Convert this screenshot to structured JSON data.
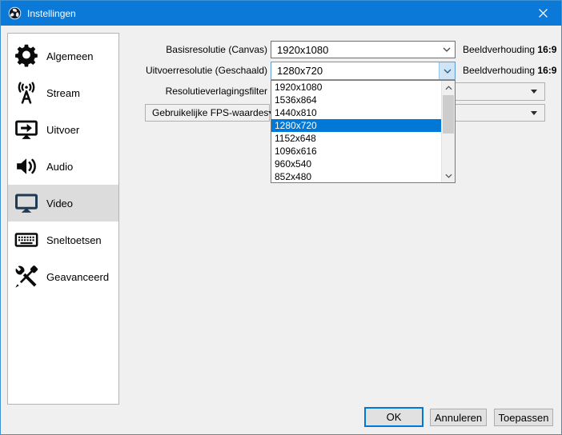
{
  "window": {
    "title": "Instellingen"
  },
  "sidebar": {
    "items": [
      {
        "label": "Algemeen",
        "icon": "gear-icon",
        "selected": false
      },
      {
        "label": "Stream",
        "icon": "broadcast-icon",
        "selected": false
      },
      {
        "label": "Uitvoer",
        "icon": "output-icon",
        "selected": false
      },
      {
        "label": "Audio",
        "icon": "speaker-icon",
        "selected": false
      },
      {
        "label": "Video",
        "icon": "monitor-icon",
        "selected": true
      },
      {
        "label": "Sneltoetsen",
        "icon": "keyboard-icon",
        "selected": false
      },
      {
        "label": "Geavanceerd",
        "icon": "tools-icon",
        "selected": false
      }
    ]
  },
  "fields": {
    "basis": {
      "label": "Basisresolutie (Canvas)",
      "value": "1920x1080",
      "aspect_label": "Beeldverhouding",
      "aspect_value": "16:9"
    },
    "output": {
      "label": "Uitvoerresolutie (Geschaald)",
      "value": "1280x720",
      "aspect_label": "Beeldverhouding",
      "aspect_value": "16:9"
    },
    "downscale": {
      "label": "Resolutieverlagingsfilter"
    },
    "fps": {
      "type_label": "Gebruikelijke FPS-waardes"
    }
  },
  "dropdown": {
    "open_for": "Uitvoerresolutie (Geschaald)",
    "selected": "1280x720",
    "options": [
      "1920x1080",
      "1536x864",
      "1440x810",
      "1280x720",
      "1152x648",
      "1096x616",
      "960x540",
      "852x480"
    ]
  },
  "footer": {
    "ok_label": "OK",
    "cancel_label": "Annuleren",
    "apply_label": "Toepassen"
  },
  "colors": {
    "titlebar": "#0b79d7",
    "selection": "#0078d7",
    "sidebar_selected_bg": "#dcdcdc",
    "video_icon": "#1f3a55",
    "window_bg": "#f0f0f0"
  }
}
